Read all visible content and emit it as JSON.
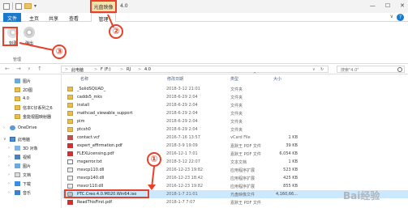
{
  "window": {
    "title": "4.0",
    "context_tab_label": "光盘映像工具",
    "controls": [
      "—",
      "☐",
      "✕"
    ]
  },
  "tabs": {
    "file": "文件",
    "home": "主页",
    "share": "共享",
    "view": "查看",
    "manage": "管理",
    "expand": "∨",
    "help": "?"
  },
  "ribbon": {
    "buttons": [
      {
        "label": "刻录"
      },
      {
        "label": "弹出"
      }
    ],
    "group_label": "管理"
  },
  "address": {
    "back": "←",
    "forward": "→",
    "dropdown": "∨",
    "up": "↑",
    "crumbs": [
      "此电脑",
      "F (F:)",
      "RJ",
      "4.0"
    ],
    "sep": ">",
    "refresh": "↻",
    "search_placeholder": "搜索\"4.0\""
  },
  "nav": {
    "items": [
      {
        "label": "图片",
        "icon": "pictures-icon"
      },
      {
        "label": "2D图",
        "icon": "folder-icon"
      },
      {
        "label": "4.0",
        "icon": "folder-icon"
      },
      {
        "label": "信本C仔系列之6",
        "icon": "folder-icon"
      },
      {
        "label": "金能视图映射器",
        "icon": "folder-icon"
      },
      {
        "label": "OneDrive",
        "icon": "onedrive-icon"
      },
      {
        "label": "此电脑",
        "icon": "this-pc-icon"
      },
      {
        "label": "3D 对象",
        "icon": "3d-objects-icon"
      },
      {
        "label": "视频",
        "icon": "videos-icon"
      },
      {
        "label": "图片",
        "icon": "pictures-icon"
      },
      {
        "label": "文档",
        "icon": "documents-icon"
      },
      {
        "label": "下载",
        "icon": "downloads-icon"
      },
      {
        "label": "音乐",
        "icon": "music-icon"
      }
    ]
  },
  "list": {
    "columns": {
      "name": "名称",
      "date": "修改日期",
      "type": "类型",
      "size": "大小"
    },
    "sort_indicator": "^",
    "rows": [
      {
        "name": "_SolidSQUAD_",
        "date": "2018-3-12 21:01",
        "type": "文件夹",
        "size": "",
        "icon": "folder"
      },
      {
        "name": "cadds5_mks",
        "date": "2018-6-29 2:04",
        "type": "文件夹",
        "size": "",
        "icon": "folder"
      },
      {
        "name": "install",
        "date": "2018-6-29 2:04",
        "type": "文件夹",
        "size": "",
        "icon": "folder"
      },
      {
        "name": "mathcad_viewable_support",
        "date": "2018-6-29 2:04",
        "type": "文件夹",
        "size": "",
        "icon": "folder"
      },
      {
        "name": "pim",
        "date": "2018-6-29 2:04",
        "type": "文件夹",
        "size": "",
        "icon": "folder"
      },
      {
        "name": "ptcsh0",
        "date": "2018-6-29 2:04",
        "type": "文件夹",
        "size": "",
        "icon": "folder"
      },
      {
        "name": "contact.vcf",
        "date": "2016-7-16 13:57",
        "type": "vCard File",
        "size": "1 KB",
        "icon": "vcf"
      },
      {
        "name": "expert_affirmation.pdf",
        "date": "2018-3-9 19:09",
        "type": "嘉默王 PDF 文件",
        "size": "39 KB",
        "icon": "pdf"
      },
      {
        "name": "FLEXLicensing.pdf",
        "date": "2016-12-1 7:01",
        "type": "嘉默王 PDF 文件",
        "size": "6,054 KB",
        "icon": "pdf"
      },
      {
        "name": "msgerror.txt",
        "date": "2018-3-12 22:07",
        "type": "文本文档",
        "size": "1 KB",
        "icon": "txt"
      },
      {
        "name": "msvcp110.dll",
        "date": "2016-12-23 19:82",
        "type": "应用程序扩展",
        "size": "523 KB",
        "icon": "dll"
      },
      {
        "name": "msvcp140.dll",
        "date": "2016-12-23 18:42",
        "type": "应用程序扩展",
        "size": "425 KB",
        "icon": "dll"
      },
      {
        "name": "msvcr110.dll",
        "date": "2016-12-23 19:82",
        "type": "应用程序扩展",
        "size": "855 KB",
        "icon": "dll"
      },
      {
        "name": "PTC.Creo.4.0.M020.Win64.iso",
        "date": "2018-1-7 21:01",
        "type": "光盘映像文件",
        "size": "4,160,66...",
        "icon": "iso"
      },
      {
        "name": "ReadThisFirst.pdf",
        "date": "2018-1-7 7:07",
        "type": "嘉默王 PDF 文件",
        "size": "",
        "icon": "pdf"
      }
    ]
  },
  "annotations": [
    "①",
    "②",
    "③"
  ],
  "watermark": "Bai经验"
}
